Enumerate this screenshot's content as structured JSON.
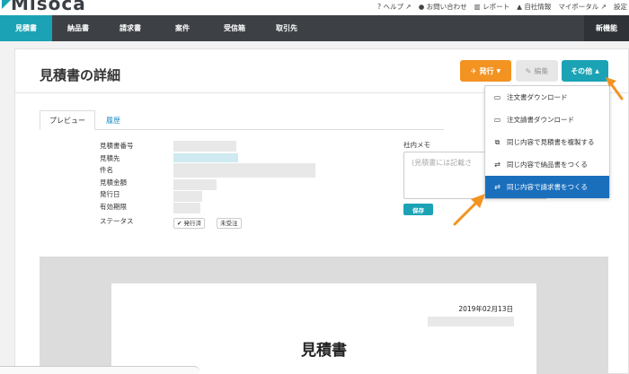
{
  "app": {
    "logo_text": "Misoca"
  },
  "util_links": [
    {
      "icon": "question-circle-icon",
      "glyph": "❓",
      "label": "ヘルプ"
    },
    {
      "icon": "speech-bubble-icon",
      "glyph": "💬",
      "label": "お問い合わせ"
    },
    {
      "icon": "bar-chart-icon",
      "glyph": "📊",
      "label": "レポート"
    },
    {
      "icon": "person-icon",
      "glyph": "👤",
      "label": "自社情報"
    },
    {
      "icon": "external-link-icon",
      "glyph": "",
      "label": "マイポータル"
    },
    {
      "icon": "",
      "glyph": "",
      "label": "設定"
    }
  ],
  "nav": {
    "items": [
      "見積書",
      "納品書",
      "請求書",
      "案件",
      "受信箱",
      "取引先"
    ],
    "active": "見積書",
    "new_label": "新機能"
  },
  "page": {
    "title": "見積書の詳細",
    "buttons": {
      "issue": "発行",
      "edit": "編集",
      "other": "その他"
    }
  },
  "dropdown": {
    "items": [
      {
        "icon": "document-icon",
        "glyph": "🗎",
        "label": "注文書ダウンロード",
        "highlighted": false
      },
      {
        "icon": "document-icon",
        "glyph": "🗎",
        "label": "注文請書ダウンロード",
        "highlighted": false
      },
      {
        "icon": "copy-icon",
        "glyph": "⧉",
        "label": "同じ内容で見積書を複製する",
        "highlighted": false
      },
      {
        "icon": "exchange-icon",
        "glyph": "⇄",
        "label": "同じ内容で納品書をつくる",
        "highlighted": false
      },
      {
        "icon": "exchange-icon",
        "glyph": "⇄",
        "label": "同じ内容で請求書をつくる",
        "highlighted": true
      }
    ]
  },
  "tabs": {
    "preview": "プレビュー",
    "history": "履歴"
  },
  "details": {
    "labels": [
      "見積書番号",
      "見積先",
      "件名",
      "見積金額",
      "発行日",
      "有効期限",
      "ステータス"
    ],
    "status_badges": [
      "発行済",
      "未受注"
    ]
  },
  "memo": {
    "label": "社内メモ",
    "placeholder": "(見積書には記載さ",
    "save_label": "保存"
  },
  "preview": {
    "date": "2019年02月13日",
    "doc_title": "見積書"
  },
  "colors": {
    "accent": "#1ba3b5",
    "nav_bg": "#3d4146",
    "issue_orange": "#f29322",
    "highlight_blue": "#1a6fbd",
    "arrow_orange": "#f29322"
  }
}
